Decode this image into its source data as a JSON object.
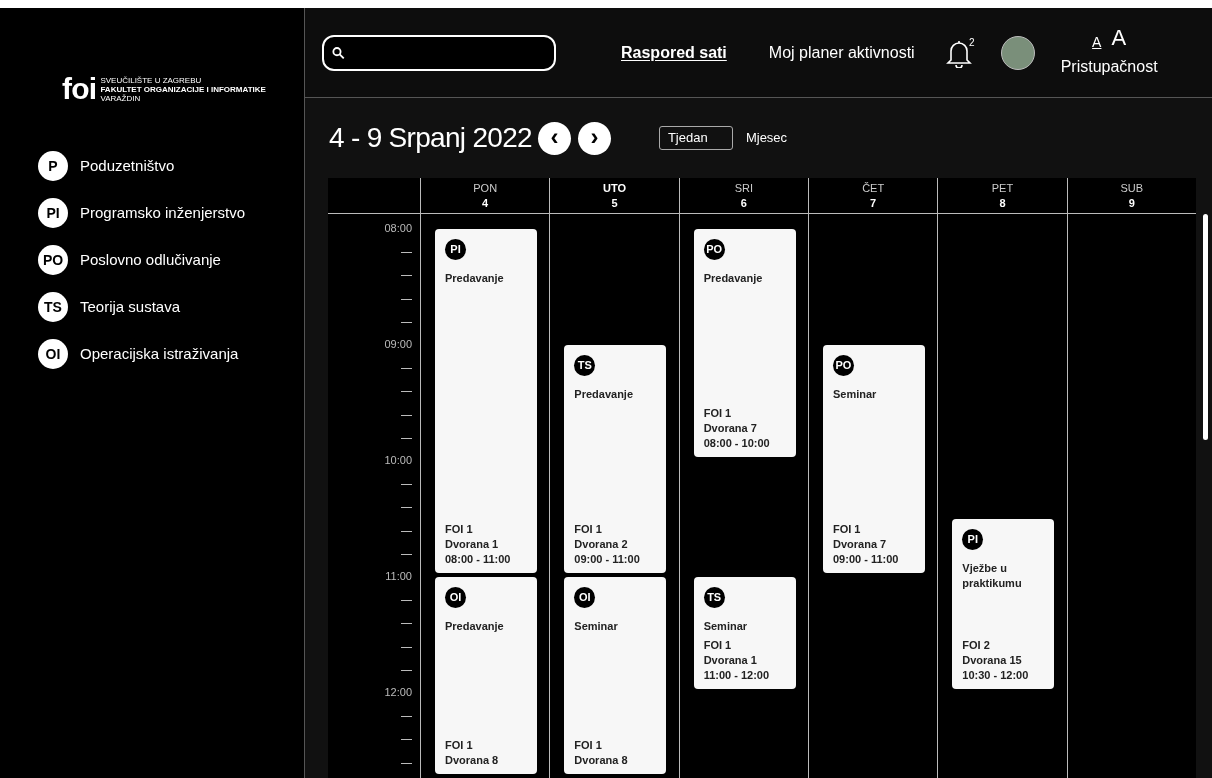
{
  "logo": {
    "mark": "foi",
    "lines": [
      "SVEUČILIŠTE U ZAGREBU",
      "FAKULTET ORGANIZACIJE I INFORMATIKE",
      "VARAŽDIN"
    ]
  },
  "subjects": [
    {
      "abbr": "P",
      "name": "Poduzetništvo"
    },
    {
      "abbr": "PI",
      "name": "Programsko inženjerstvo"
    },
    {
      "abbr": "PO",
      "name": "Poslovno odlučivanje"
    },
    {
      "abbr": "TS",
      "name": "Teorija sustava"
    },
    {
      "abbr": "OI",
      "name": "Operacijska istraživanja"
    }
  ],
  "nav": [
    {
      "label": "Raspored sati",
      "selected": true
    },
    {
      "label": "Moj planer aktivnosti",
      "selected": false
    }
  ],
  "notifications": {
    "count": "2"
  },
  "accessibility": {
    "small": "A",
    "large": "A",
    "label": "Pristupačnost"
  },
  "period": {
    "title": "4 - 9 Srpanj 2022",
    "prev": "‹",
    "next": "›"
  },
  "views": [
    {
      "label": "Tjedan",
      "selected": true
    },
    {
      "label": "Mjesec",
      "selected": false
    }
  ],
  "hours": [
    "08:00",
    "09:00",
    "10:00",
    "11:00",
    "12:00"
  ],
  "days": [
    {
      "name": "PON",
      "date": "4",
      "selected": false,
      "events": [
        {
          "abbr": "PI",
          "title": "Predavanje",
          "building": "FOI 1",
          "room": "Dvorana 1",
          "time": "08:00 - 11:00"
        },
        {
          "abbr": "OI",
          "title": "Predavanje",
          "building": "FOI 1",
          "room": "Dvorana 8"
        }
      ]
    },
    {
      "name": "UTO",
      "date": "5",
      "selected": true,
      "events": [
        {
          "abbr": "TS",
          "title": "Predavanje",
          "building": "FOI 1",
          "room": "Dvorana 2",
          "time": "09:00 - 11:00"
        },
        {
          "abbr": "OI",
          "title": "Seminar",
          "building": "FOI 1",
          "room": "Dvorana 8"
        }
      ]
    },
    {
      "name": "SRI",
      "date": "6",
      "selected": false,
      "events": [
        {
          "abbr": "PO",
          "title": "Predavanje",
          "building": "FOI 1",
          "room": "Dvorana 7",
          "time": "08:00 - 10:00"
        },
        {
          "abbr": "TS",
          "title": "Seminar",
          "building": "FOI 1",
          "room": "Dvorana 1",
          "time": "11:00 - 12:00"
        }
      ]
    },
    {
      "name": "ČET",
      "date": "7",
      "selected": false,
      "events": [
        {
          "abbr": "PO",
          "title": "Seminar",
          "building": "FOI 1",
          "room": "Dvorana 7",
          "time": "09:00 - 11:00"
        }
      ]
    },
    {
      "name": "PET",
      "date": "8",
      "selected": false,
      "events": [
        {
          "abbr": "PI",
          "title": "Vježbe u praktikumu",
          "building": "FOI 2",
          "room": "Dvorana 15",
          "time": "10:30 - 12:00"
        }
      ]
    },
    {
      "name": "SUB",
      "date": "9",
      "selected": false
    }
  ]
}
